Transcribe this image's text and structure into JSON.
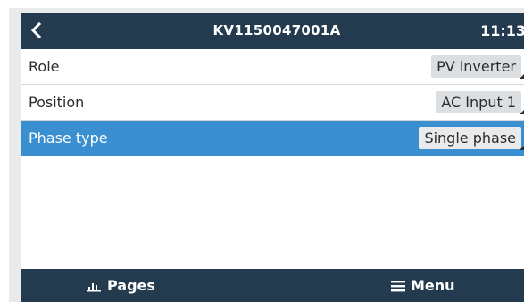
{
  "header": {
    "title": "KV1150047001A",
    "clock": "11:13"
  },
  "rows": [
    {
      "label": "Role",
      "value": "PV inverter",
      "selected": false
    },
    {
      "label": "Position",
      "value": "AC Input 1",
      "selected": false
    },
    {
      "label": "Phase type",
      "value": "Single phase",
      "selected": true
    }
  ],
  "footer": {
    "pages_label": "Pages",
    "menu_label": "Menu"
  },
  "colors": {
    "bar": "#243b4f",
    "selected": "#3a8fd0",
    "value_bg": "#dcdfe2"
  },
  "icons": [
    "back-icon",
    "pages-icon",
    "menu-icon"
  ]
}
